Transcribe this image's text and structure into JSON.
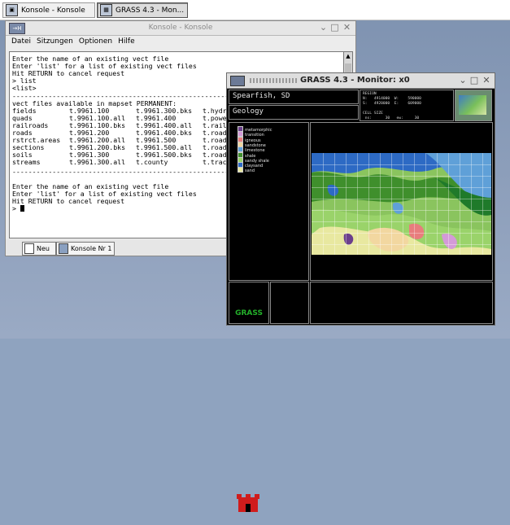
{
  "taskbar": {
    "tasks": [
      {
        "label": "Konsole - Konsole",
        "active": false
      },
      {
        "label": "GRASS 4.3 - Mon...",
        "active": true
      }
    ]
  },
  "konsole": {
    "title": "Konsole - Konsole",
    "title_prefix": "→H",
    "menu": [
      "Datei",
      "Sitzungen",
      "Optionen",
      "Hilfe"
    ],
    "terminal_lines": [
      "Enter the name of an existing vect file",
      "Enter 'list' for a list of existing vect files",
      "Hit RETURN to cancel request",
      "> list",
      "<list>",
      "----------------------------------------------------------",
      "vect files available in mapset PERMANENT:"
    ],
    "vect_table": [
      [
        "fields",
        "t.9961.100",
        "t.9961.300.bks",
        "t.hydr"
      ],
      [
        "quads",
        "t.9961.100.all",
        "t.9961.400",
        "t.powe"
      ],
      [
        "railroads",
        "t.9961.100.bks",
        "t.9961.400.all",
        "t.rail"
      ],
      [
        "roads",
        "t.9961.200",
        "t.9961.400.bks",
        "t.road"
      ],
      [
        "rstrct.areas",
        "t.9961.200.all",
        "t.9961.500",
        "t.road"
      ],
      [
        "sections",
        "t.9961.200.bks",
        "t.9961.500.all",
        "t.road"
      ],
      [
        "soils",
        "t.9961.300",
        "t.9961.500.bks",
        "t.road"
      ],
      [
        "streams",
        "t.9961.300.all",
        "t.county",
        "t.trac"
      ]
    ],
    "terminal_lines_after": [
      "----------------------------------------------------------",
      "",
      "Enter the name of an existing vect file",
      "Enter 'list' for a list of existing vect files",
      "Hit RETURN to cancel request",
      "> "
    ],
    "tabs": [
      {
        "label": "Neu"
      },
      {
        "label": "Konsole Nr 1"
      }
    ]
  },
  "grass": {
    "title": "GRASS 4.3 - Monitor: x0",
    "location": "Spearfish, SD",
    "map_name": "Geology",
    "region_info": "REGION\nN:   4914000  W:    590000\nS:   4920000  E:    609000\n\nCELL SIZE\n ns:      30   ew:     30",
    "legend": [
      {
        "label": "metamorphic",
        "color": "#6b3f8c"
      },
      {
        "label": "transition",
        "color": "#d49ad8"
      },
      {
        "label": "igneous",
        "color": "#e87d7d"
      },
      {
        "label": "sandstone",
        "color": "#f2d7a0"
      },
      {
        "label": "limestone",
        "color": "#5fa0d8"
      },
      {
        "label": "shale",
        "color": "#3f8f2c"
      },
      {
        "label": "sandy shale",
        "color": "#9ad36a"
      },
      {
        "label": "claysand",
        "color": "#2d6ac4"
      },
      {
        "label": "sand",
        "color": "#e8e8a0"
      }
    ],
    "logo_text": "GRASS"
  }
}
